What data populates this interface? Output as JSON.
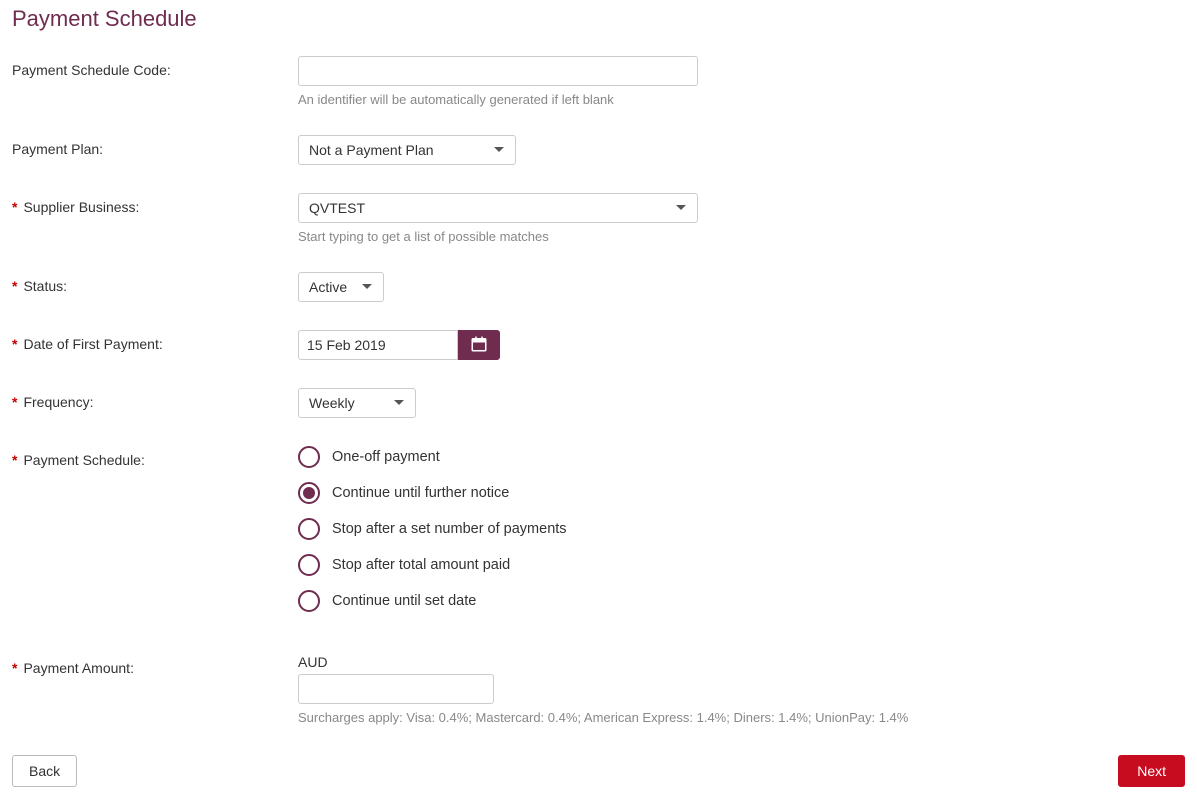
{
  "title": "Payment Schedule",
  "labels": {
    "schedule_code": "Payment Schedule Code:",
    "payment_plan": "Payment Plan:",
    "supplier_business": "Supplier Business:",
    "status": "Status:",
    "first_payment_date": "Date of First Payment:",
    "frequency": "Frequency:",
    "payment_schedule": "Payment Schedule:",
    "payment_amount": "Payment Amount:"
  },
  "schedule_code": {
    "value": "",
    "helper": "An identifier will be automatically generated if left blank"
  },
  "payment_plan": {
    "selected": "Not a Payment Plan"
  },
  "supplier_business": {
    "value": "QVTEST",
    "helper": "Start typing to get a list of possible matches"
  },
  "status": {
    "selected": "Active"
  },
  "first_payment_date": {
    "value": "15 Feb 2019"
  },
  "frequency": {
    "selected": "Weekly"
  },
  "schedule_options": [
    {
      "label": "One-off payment",
      "selected": false
    },
    {
      "label": "Continue until further notice",
      "selected": true
    },
    {
      "label": "Stop after a set number of payments",
      "selected": false
    },
    {
      "label": "Stop after total amount paid",
      "selected": false
    },
    {
      "label": "Continue until set date",
      "selected": false
    }
  ],
  "payment_amount": {
    "currency": "AUD",
    "value": "",
    "helper": "Surcharges apply: Visa: 0.4%; Mastercard: 0.4%; American Express: 1.4%; Diners: 1.4%; UnionPay: 1.4%"
  },
  "buttons": {
    "back": "Back",
    "next": "Next"
  }
}
